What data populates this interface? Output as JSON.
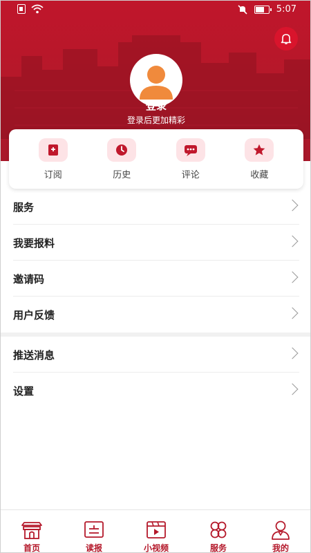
{
  "status_bar": {
    "time": "5:07"
  },
  "header": {
    "login_title": "登录",
    "login_subtitle": "登录后更加精彩"
  },
  "quick_actions": [
    {
      "label": "订阅",
      "icon": "subscribe-icon"
    },
    {
      "label": "历史",
      "icon": "history-icon"
    },
    {
      "label": "评论",
      "icon": "comment-icon"
    },
    {
      "label": "收藏",
      "icon": "favorite-star-icon"
    }
  ],
  "menu": {
    "group1": [
      {
        "label": "服务"
      },
      {
        "label": "我要报料"
      },
      {
        "label": "邀请码"
      },
      {
        "label": "用户反馈"
      }
    ],
    "group2": [
      {
        "label": "推送消息"
      },
      {
        "label": "设置"
      }
    ]
  },
  "bottom_nav": [
    {
      "label": "首页",
      "icon": "home-gate-icon"
    },
    {
      "label": "读报",
      "icon": "newspaper-icon"
    },
    {
      "label": "小视频",
      "icon": "video-icon"
    },
    {
      "label": "服务",
      "icon": "service-clover-icon"
    },
    {
      "label": "我的",
      "icon": "profile-icon"
    }
  ],
  "colors": {
    "brand_red": "#b4182a",
    "quick_icon_bg": "#fde3e6"
  }
}
